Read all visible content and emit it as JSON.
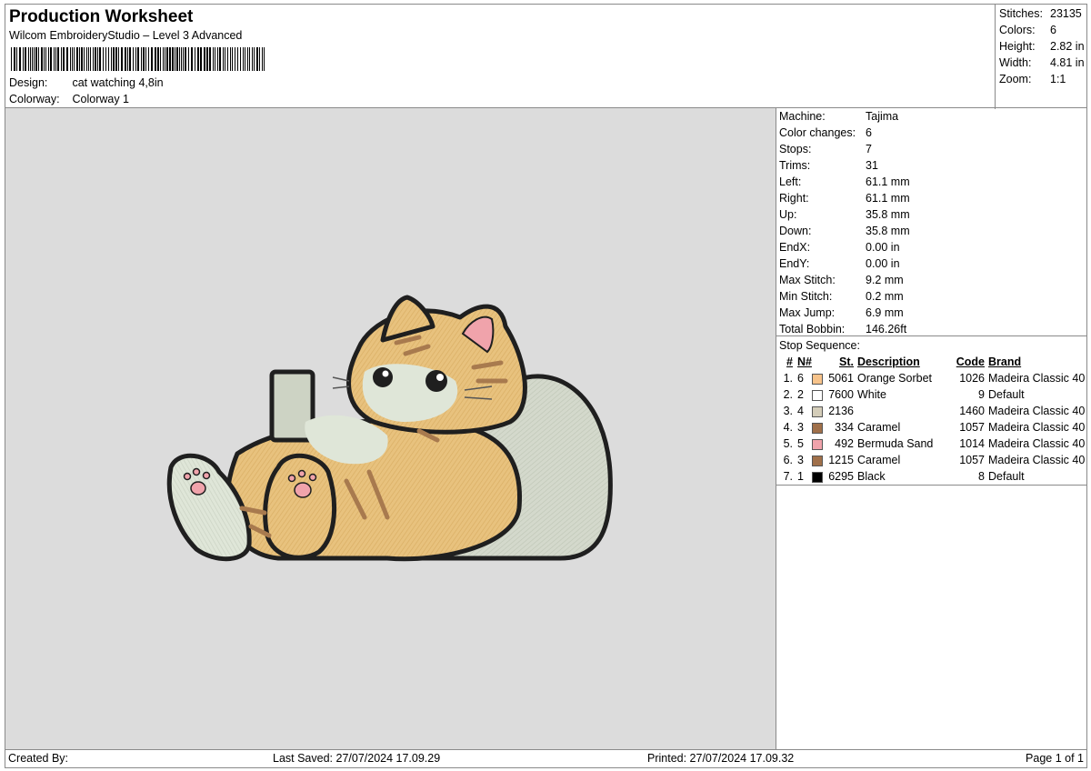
{
  "header": {
    "title": "Production Worksheet",
    "subtitle": "Wilcom EmbroideryStudio – Level 3 Advanced",
    "design_label": "Design:",
    "design_value": "cat watching 4,8in",
    "colorway_label": "Colorway:",
    "colorway_value": "Colorway 1"
  },
  "summary": [
    {
      "label": "Stitches:",
      "value": "23135"
    },
    {
      "label": "Colors:",
      "value": "6"
    },
    {
      "label": "Height:",
      "value": "2.82 in"
    },
    {
      "label": "Width:",
      "value": "4.81 in"
    },
    {
      "label": "Zoom:",
      "value": "1:1"
    }
  ],
  "machine_info": [
    {
      "label": "Machine:",
      "value": "Tajima"
    },
    {
      "label": "Color changes:",
      "value": "6"
    },
    {
      "label": "Stops:",
      "value": "7"
    },
    {
      "label": "Trims:",
      "value": "31"
    },
    {
      "label": "Left:",
      "value": "61.1 mm"
    },
    {
      "label": "Right:",
      "value": "61.1 mm"
    },
    {
      "label": "Up:",
      "value": "35.8 mm"
    },
    {
      "label": "Down:",
      "value": "35.8 mm"
    },
    {
      "label": "EndX:",
      "value": "0.00 in"
    },
    {
      "label": "EndY:",
      "value": "0.00 in"
    },
    {
      "label": "Max Stitch:",
      "value": "9.2 mm"
    },
    {
      "label": "Min Stitch:",
      "value": "0.2 mm"
    },
    {
      "label": "Max Jump:",
      "value": "6.9 mm"
    },
    {
      "label": "Total Bobbin:",
      "value": "146.26ft"
    }
  ],
  "stop_sequence": {
    "title": "Stop Sequence:",
    "headers": {
      "num": "#",
      "n": "N#",
      "st": "St.",
      "desc": "Description",
      "code": "Code",
      "brand": "Brand"
    },
    "rows": [
      {
        "num": "1.",
        "n": "6",
        "color": "#f7c38a",
        "st": "5061",
        "desc": "Orange Sorbet",
        "code": "1026",
        "brand": "Madeira Classic 40"
      },
      {
        "num": "2.",
        "n": "2",
        "color": "#ffffff",
        "st": "7600",
        "desc": "White",
        "code": "9",
        "brand": "Default"
      },
      {
        "num": "3.",
        "n": "4",
        "color": "#d4cdb9",
        "st": "2136",
        "desc": "",
        "code": "1460",
        "brand": "Madeira Classic 40"
      },
      {
        "num": "4.",
        "n": "3",
        "color": "#a0704a",
        "st": "334",
        "desc": "Caramel",
        "code": "1057",
        "brand": "Madeira Classic 40"
      },
      {
        "num": "5.",
        "n": "5",
        "color": "#f0a3ab",
        "st": "492",
        "desc": "Bermuda Sand",
        "code": "1014",
        "brand": "Madeira Classic 40"
      },
      {
        "num": "6.",
        "n": "3",
        "color": "#a0704a",
        "st": "1215",
        "desc": "Caramel",
        "code": "1057",
        "brand": "Madeira Classic 40"
      },
      {
        "num": "7.",
        "n": "1",
        "color": "#000000",
        "st": "6295",
        "desc": "Black",
        "code": "8",
        "brand": "Default"
      }
    ]
  },
  "footer": {
    "created_by": "Created By:",
    "last_saved": "Last Saved: 27/07/2024 17.09.29",
    "printed": "Printed: 27/07/2024 17.09.32",
    "page": "Page 1 of 1"
  },
  "colors": {
    "preview_background": "#dcdcdc",
    "outline": "#1f1f1f",
    "fur_orange": "#e8c27e",
    "fur_white": "#dfe6d8",
    "stripes": "#a87a4e",
    "paw_pink": "#f0a3ab"
  },
  "design_preview": {
    "subject": "cat lying on a cushion watching a phone"
  }
}
